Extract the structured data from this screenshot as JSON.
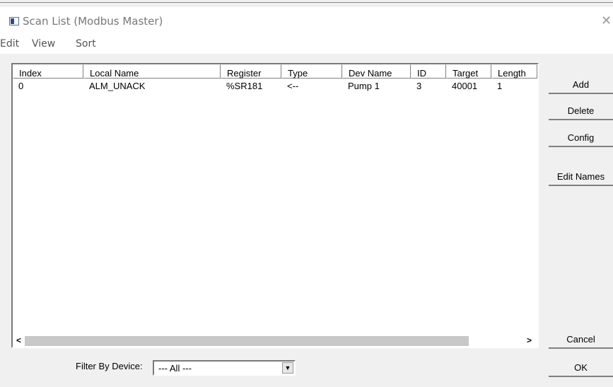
{
  "window": {
    "title": "Scan List (Modbus Master)",
    "close_glyph": "✕"
  },
  "menu": [
    "Edit",
    "View",
    "Sort"
  ],
  "list": {
    "columns": [
      "Index",
      "Local Name",
      "Register",
      "Type",
      "Dev Name",
      "ID",
      "Target",
      "Length"
    ],
    "rows": [
      {
        "index": "0",
        "local_name": "ALM_UNACK",
        "register": "%SR181",
        "type": "<--",
        "dev_name": "Pump 1",
        "id": "3",
        "target": "40001",
        "length": "1"
      }
    ],
    "scroll_left": "<",
    "scroll_right": ">"
  },
  "buttons": {
    "add": "Add",
    "delete": "Delete",
    "config": "Config",
    "edit_names": "Edit Names",
    "cancel": "Cancel",
    "ok": "OK"
  },
  "filter": {
    "label": "Filter By Device:",
    "value": "--- All ---",
    "arrow": "▼"
  }
}
